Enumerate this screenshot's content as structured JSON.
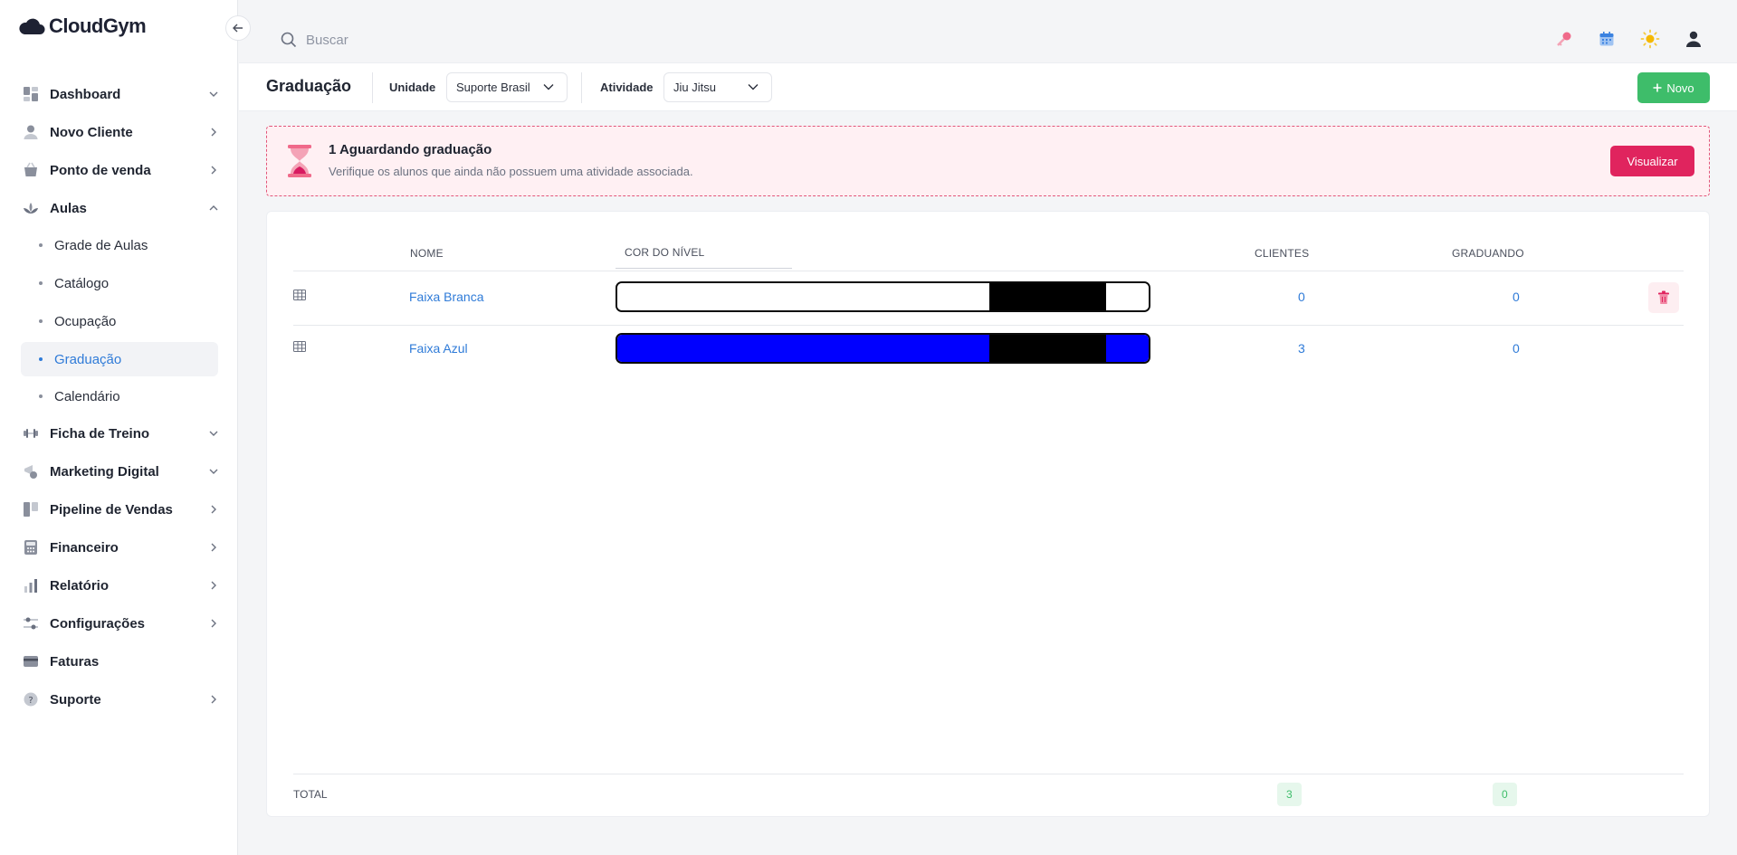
{
  "app": {
    "name": "CloudGym"
  },
  "search": {
    "placeholder": "Buscar"
  },
  "sidebar": {
    "items": [
      {
        "label": "Dashboard",
        "icon": "dashboard-icon",
        "chevron": "down"
      },
      {
        "label": "Novo Cliente",
        "icon": "user-icon",
        "chevron": "right"
      },
      {
        "label": "Ponto de venda",
        "icon": "basket-icon",
        "chevron": "right"
      },
      {
        "label": "Aulas",
        "icon": "lotus-icon",
        "chevron": "up"
      },
      {
        "label": "Ficha de Treino",
        "icon": "dumbbell-icon",
        "chevron": "down"
      },
      {
        "label": "Marketing Digital",
        "icon": "megaphone-icon",
        "chevron": "down"
      },
      {
        "label": "Pipeline de Vendas",
        "icon": "kanban-icon",
        "chevron": "right"
      },
      {
        "label": "Financeiro",
        "icon": "calculator-icon",
        "chevron": "right"
      },
      {
        "label": "Relatório",
        "icon": "bar-chart-icon",
        "chevron": "right"
      },
      {
        "label": "Configurações",
        "icon": "sliders-icon",
        "chevron": "right"
      },
      {
        "label": "Faturas",
        "icon": "credit-card-icon",
        "chevron": ""
      },
      {
        "label": "Suporte",
        "icon": "help-icon",
        "chevron": "right"
      }
    ],
    "aulas_sub": [
      {
        "label": "Grade de Aulas"
      },
      {
        "label": "Catálogo"
      },
      {
        "label": "Ocupação"
      },
      {
        "label": "Graduação",
        "active": true
      },
      {
        "label": "Calendário"
      }
    ]
  },
  "header": {
    "title": "Graduação",
    "unidade_label": "Unidade",
    "unidade_value": "Suporte Brasil",
    "atividade_label": "Atividade",
    "atividade_value": "Jiu Jitsu",
    "new_button": "Novo"
  },
  "alert": {
    "title": "1 Aguardando graduação",
    "description": "Verifique os alunos que ainda não possuem uma atividade associada.",
    "button": "Visualizar"
  },
  "table": {
    "columns": {
      "nome": "NOME",
      "cor": "COR DO NÍVEL",
      "clientes": "CLIENTES",
      "graduando": "GRADUANDO"
    },
    "rows": [
      {
        "nome": "Faixa Branca",
        "belt_color": "#ffffff",
        "clientes": "0",
        "graduando": "0"
      },
      {
        "nome": "Faixa Azul",
        "belt_color": "#0000ff",
        "clientes": "3",
        "graduando": "0"
      }
    ],
    "total": {
      "label": "TOTAL",
      "clientes": "3",
      "graduando": "0"
    }
  },
  "colors": {
    "accent": "#2f7bd8",
    "success": "#3ebd6a",
    "danger": "#e0245e"
  }
}
